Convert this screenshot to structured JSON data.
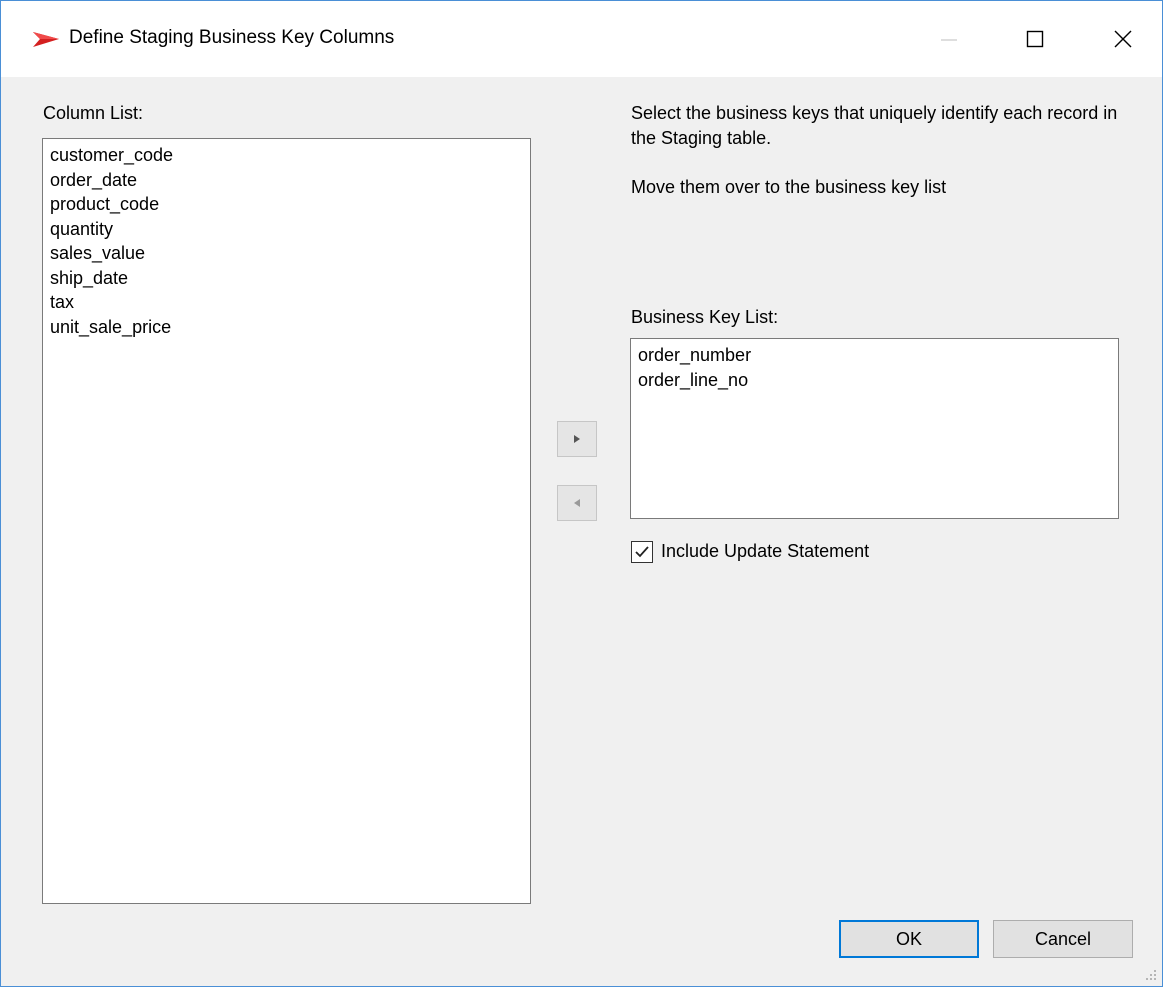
{
  "window": {
    "title": "Define Staging Business Key Columns",
    "accent_color": "#0078d7",
    "icons": {
      "app": "red-arrow-logo-icon",
      "minimize": "minimize-icon",
      "maximize": "maximize-icon",
      "close": "close-icon"
    }
  },
  "column_list": {
    "label": "Column List:",
    "items": [
      "customer_code",
      "order_date",
      "product_code",
      "quantity",
      "sales_value",
      "ship_date",
      "tax",
      "unit_sale_price"
    ]
  },
  "description": {
    "line1": "Select the business keys that uniquely identify each record in the Staging table.",
    "line2": "Move them over to the business key list"
  },
  "business_key_list": {
    "label": "Business Key List:",
    "items": [
      "order_number",
      "order_line_no"
    ]
  },
  "move_buttons": {
    "add_icon": "arrow-right-icon",
    "remove_icon": "arrow-left-icon"
  },
  "include_update": {
    "label": "Include Update Statement",
    "checked": true
  },
  "buttons": {
    "ok": "OK",
    "cancel": "Cancel"
  }
}
